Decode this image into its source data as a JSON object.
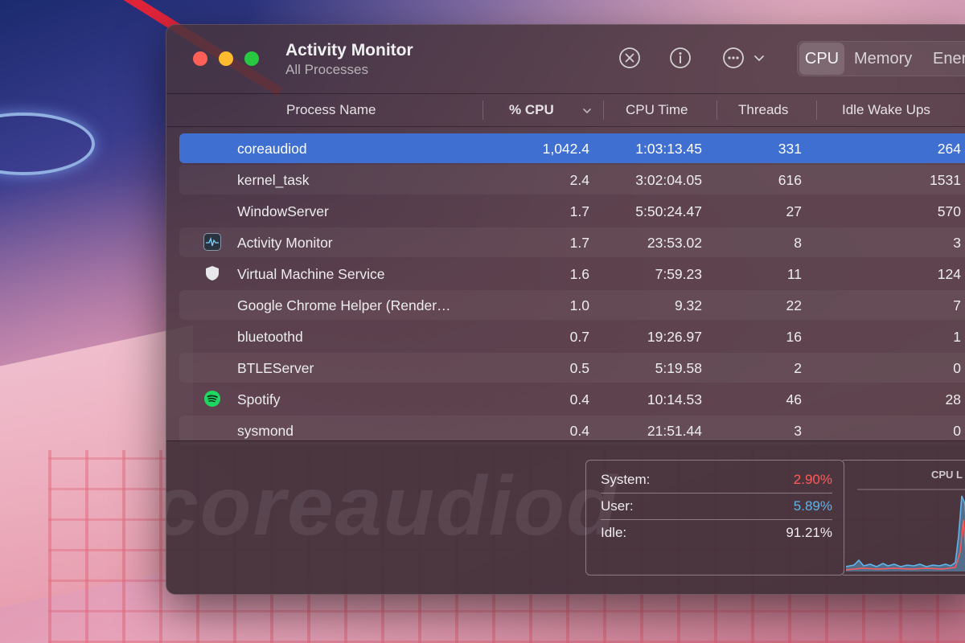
{
  "window": {
    "title": "Activity Monitor",
    "subtitle": "All Processes"
  },
  "toolbar": {
    "icons": [
      "stop-process-icon",
      "info-icon",
      "more-options-icon",
      "chevron-down-icon"
    ],
    "tabs": [
      {
        "label": "CPU",
        "selected": true
      },
      {
        "label": "Memory",
        "selected": false
      },
      {
        "label": "Ener",
        "selected": false
      }
    ]
  },
  "columns": {
    "name": "Process Name",
    "cpu": "% CPU",
    "cpu_time": "CPU Time",
    "threads": "Threads",
    "idle_wake_ups": "Idle Wake Ups"
  },
  "processes": [
    {
      "name": "coreaudiod",
      "cpu": "1,042.4",
      "time": "1:03:13.45",
      "threads": "331",
      "idle": "264",
      "icon": ""
    },
    {
      "name": "kernel_task",
      "cpu": "2.4",
      "time": "3:02:04.05",
      "threads": "616",
      "idle": "1531",
      "icon": ""
    },
    {
      "name": "WindowServer",
      "cpu": "1.7",
      "time": "5:50:24.47",
      "threads": "27",
      "idle": "570",
      "icon": ""
    },
    {
      "name": "Activity Monitor",
      "cpu": "1.7",
      "time": "23:53.02",
      "threads": "8",
      "idle": "3",
      "icon": "activity-monitor-icon"
    },
    {
      "name": "Virtual Machine Service",
      "cpu": "1.6",
      "time": "7:59.23",
      "threads": "11",
      "idle": "124",
      "icon": "shield-icon"
    },
    {
      "name": "Google Chrome Helper (Render…",
      "cpu": "1.0",
      "time": "9.32",
      "threads": "22",
      "idle": "7",
      "icon": ""
    },
    {
      "name": "bluetoothd",
      "cpu": "0.7",
      "time": "19:26.97",
      "threads": "16",
      "idle": "1",
      "icon": ""
    },
    {
      "name": "BTLEServer",
      "cpu": "0.5",
      "time": "5:19.58",
      "threads": "2",
      "idle": "0",
      "icon": ""
    },
    {
      "name": "Spotify",
      "cpu": "0.4",
      "time": "10:14.53",
      "threads": "46",
      "idle": "28",
      "icon": "spotify-icon"
    },
    {
      "name": "sysmond",
      "cpu": "0.4",
      "time": "21:51.44",
      "threads": "3",
      "idle": "0",
      "icon": ""
    }
  ],
  "selected_process": "coreaudiod",
  "summary": {
    "system_label": "System:",
    "system_value": "2.90%",
    "user_label": "User:",
    "user_value": "5.89%",
    "idle_label": "Idle:",
    "idle_value": "91.21%",
    "load_title": "CPU L"
  },
  "colors": {
    "selection": "#3f6fd0",
    "system": "#ff5b5b",
    "user": "#5fb4e8",
    "spotify": "#1ed760"
  }
}
